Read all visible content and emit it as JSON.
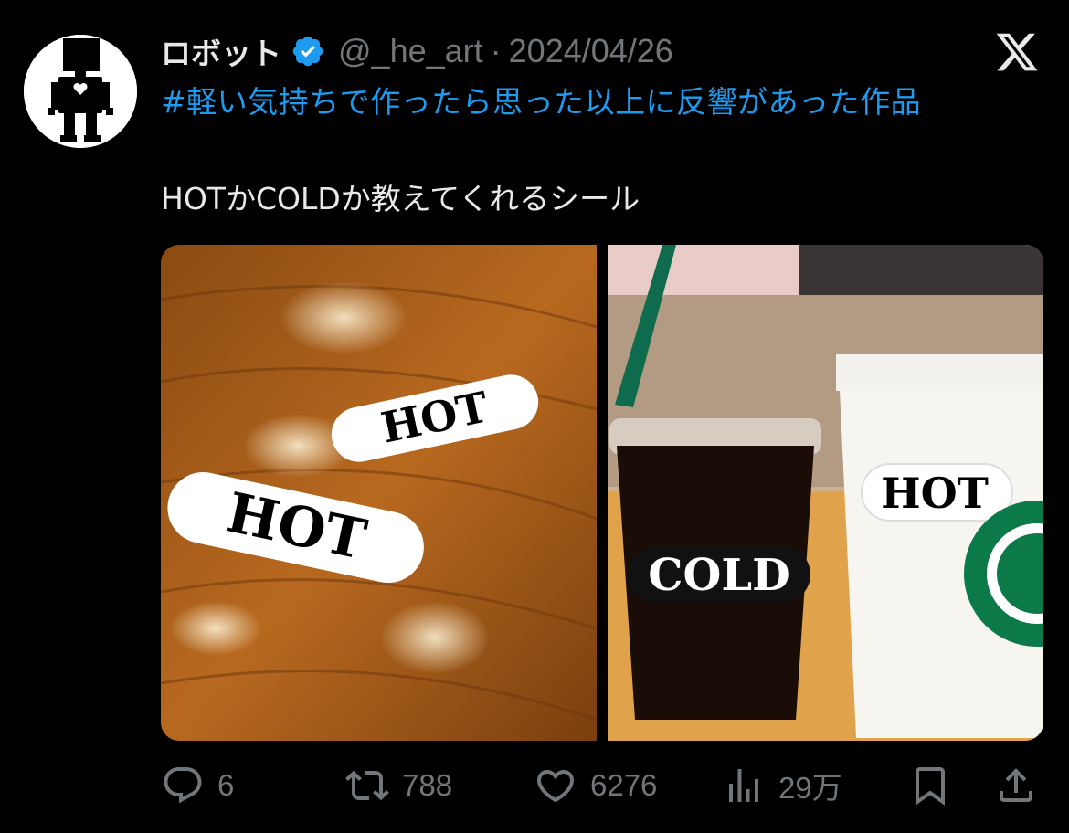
{
  "tweet": {
    "display_name": "ロボット",
    "handle": "@_he_art",
    "separator": "·",
    "date": "2024/04/26",
    "hashtag": "#軽い気持ちで作ったら思った以上に反響があった作品",
    "text": "HOTかCOLDか教えてくれるシール"
  },
  "media": {
    "left_photo": {
      "stickers": [
        "HOT",
        "HOT"
      ]
    },
    "right_photo": {
      "cold_cup_label": "COLD",
      "hot_cup_label": "HOT"
    }
  },
  "actions": {
    "replies": "6",
    "reposts": "788",
    "likes": "6276",
    "views": "29万"
  },
  "icons": {
    "verified": "verified-badge-icon",
    "platform": "x-logo-icon",
    "reply": "reply-icon",
    "repost": "repost-icon",
    "like": "heart-icon",
    "views": "views-chart-icon",
    "bookmark": "bookmark-icon",
    "share": "share-icon"
  },
  "colors": {
    "background": "#000000",
    "primary_text": "#e7e9ea",
    "secondary_text": "#71767b",
    "link": "#1d9bf0",
    "verified": "#1d9bf0"
  }
}
